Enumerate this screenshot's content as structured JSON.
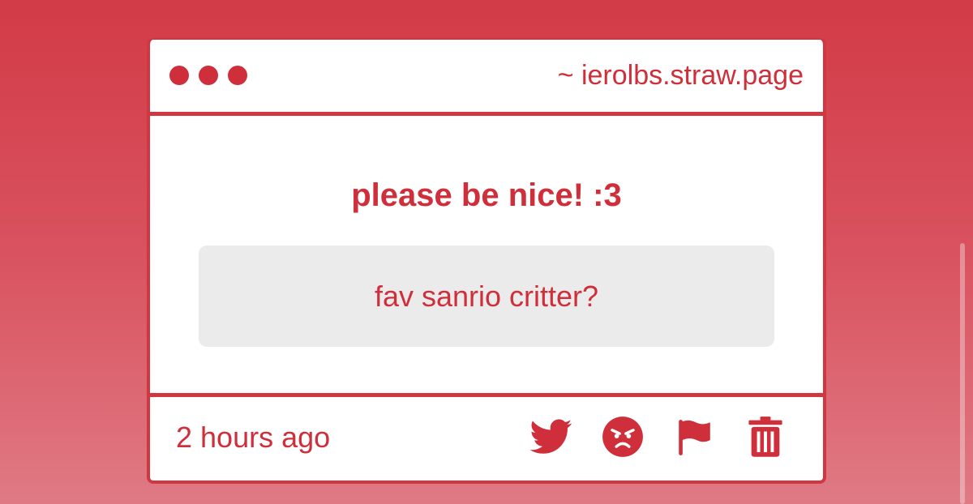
{
  "window": {
    "url": "~ ierolbs.straw.page"
  },
  "main": {
    "heading": "please be nice! :3",
    "question": "fav sanrio critter?"
  },
  "footer": {
    "time": "2 hours ago",
    "actions": [
      {
        "icon": "twitter-icon"
      },
      {
        "icon": "angry-face-icon"
      },
      {
        "icon": "flag-icon"
      },
      {
        "icon": "trash-icon"
      }
    ]
  },
  "colors": {
    "accent": "#cf2f3a",
    "background_top": "#d23b47",
    "background_bottom": "#df7a84",
    "question_bg": "#ebebec"
  }
}
